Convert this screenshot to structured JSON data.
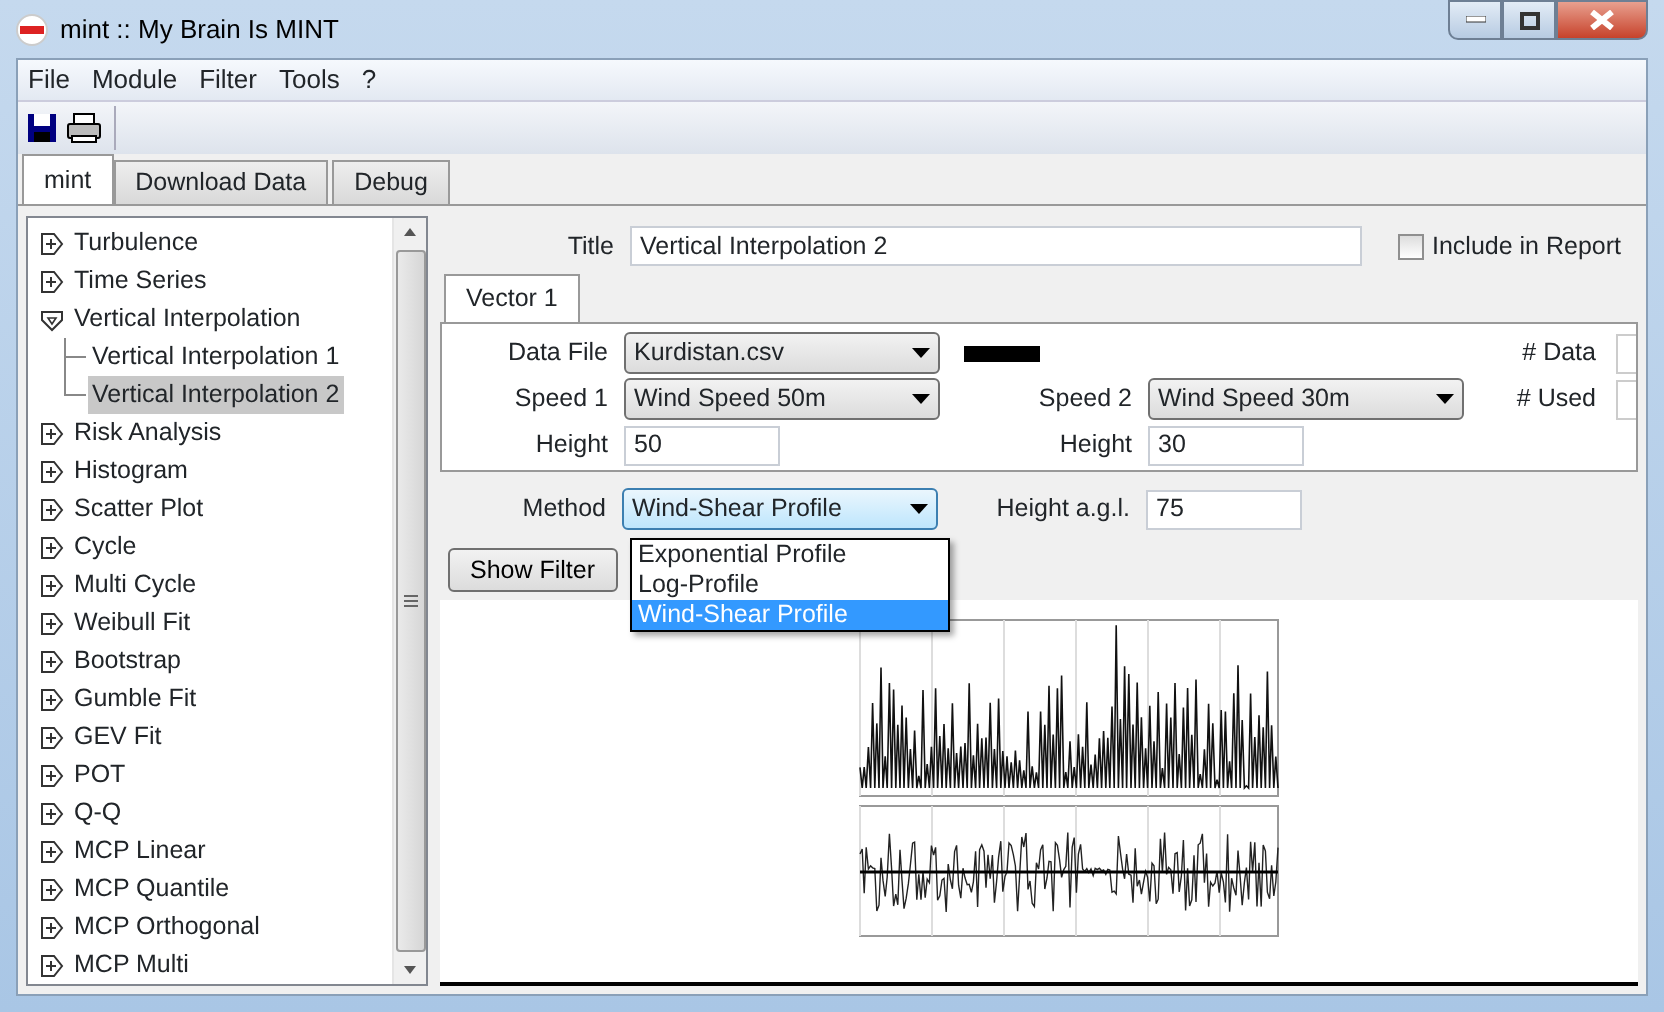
{
  "window": {
    "title": "mint :: My Brain Is MINT"
  },
  "menu": [
    "File",
    "Module",
    "Filter",
    "Tools",
    "?"
  ],
  "tabs": [
    {
      "label": "mint",
      "selected": true
    },
    {
      "label": "Download Data",
      "selected": false
    },
    {
      "label": "Debug",
      "selected": false
    }
  ],
  "tree": [
    {
      "label": "Turbulence",
      "expanded": false,
      "selected": false
    },
    {
      "label": "Time Series",
      "expanded": false,
      "selected": false
    },
    {
      "label": "Vertical Interpolation",
      "expanded": true,
      "selected": false,
      "children": [
        {
          "label": "Vertical Interpolation 1",
          "selected": false
        },
        {
          "label": "Vertical Interpolation 2",
          "selected": true
        }
      ]
    },
    {
      "label": "Risk Analysis",
      "expanded": false,
      "selected": false
    },
    {
      "label": "Histogram",
      "expanded": false,
      "selected": false
    },
    {
      "label": "Scatter Plot",
      "expanded": false,
      "selected": false
    },
    {
      "label": "Cycle",
      "expanded": false,
      "selected": false
    },
    {
      "label": "Multi Cycle",
      "expanded": false,
      "selected": false
    },
    {
      "label": "Weibull Fit",
      "expanded": false,
      "selected": false
    },
    {
      "label": "Bootstrap",
      "expanded": false,
      "selected": false
    },
    {
      "label": "Gumble Fit",
      "expanded": false,
      "selected": false
    },
    {
      "label": "GEV Fit",
      "expanded": false,
      "selected": false
    },
    {
      "label": "POT",
      "expanded": false,
      "selected": false
    },
    {
      "label": "Q-Q",
      "expanded": false,
      "selected": false
    },
    {
      "label": "MCP Linear",
      "expanded": false,
      "selected": false
    },
    {
      "label": "MCP Quantile",
      "expanded": false,
      "selected": false
    },
    {
      "label": "MCP Orthogonal",
      "expanded": false,
      "selected": false
    },
    {
      "label": "MCP Multi",
      "expanded": false,
      "selected": false
    }
  ],
  "form": {
    "title": {
      "label": "Title",
      "value": "Vertical Interpolation 2"
    },
    "include_in_report": {
      "label": "Include in Report",
      "checked": false
    },
    "vector_tabs": [
      {
        "label": "Vector 1",
        "selected": true
      }
    ],
    "data_file": {
      "label": "Data File",
      "value": "Kurdistan.csv",
      "color": "#000000"
    },
    "data_count_label": "# Data",
    "speed_1": {
      "label": "Speed 1",
      "value": "Wind Speed 50m"
    },
    "speed_2": {
      "label": "Speed 2",
      "value": "Wind Speed 30m"
    },
    "used_count_label": "# Used",
    "height_1": {
      "label": "Height",
      "value": "50"
    },
    "height_2": {
      "label": "Height",
      "value": "30"
    },
    "method": {
      "label": "Method",
      "value": "Wind-Shear Profile",
      "open": true,
      "options": [
        {
          "label": "Exponential Profile",
          "selected": false
        },
        {
          "label": "Log-Profile",
          "selected": false
        },
        {
          "label": "Wind-Shear Profile",
          "selected": true
        }
      ]
    },
    "height_agl": {
      "label": "Height a.g.l.",
      "value": "75"
    },
    "show_filter_button": "Show Filter"
  }
}
